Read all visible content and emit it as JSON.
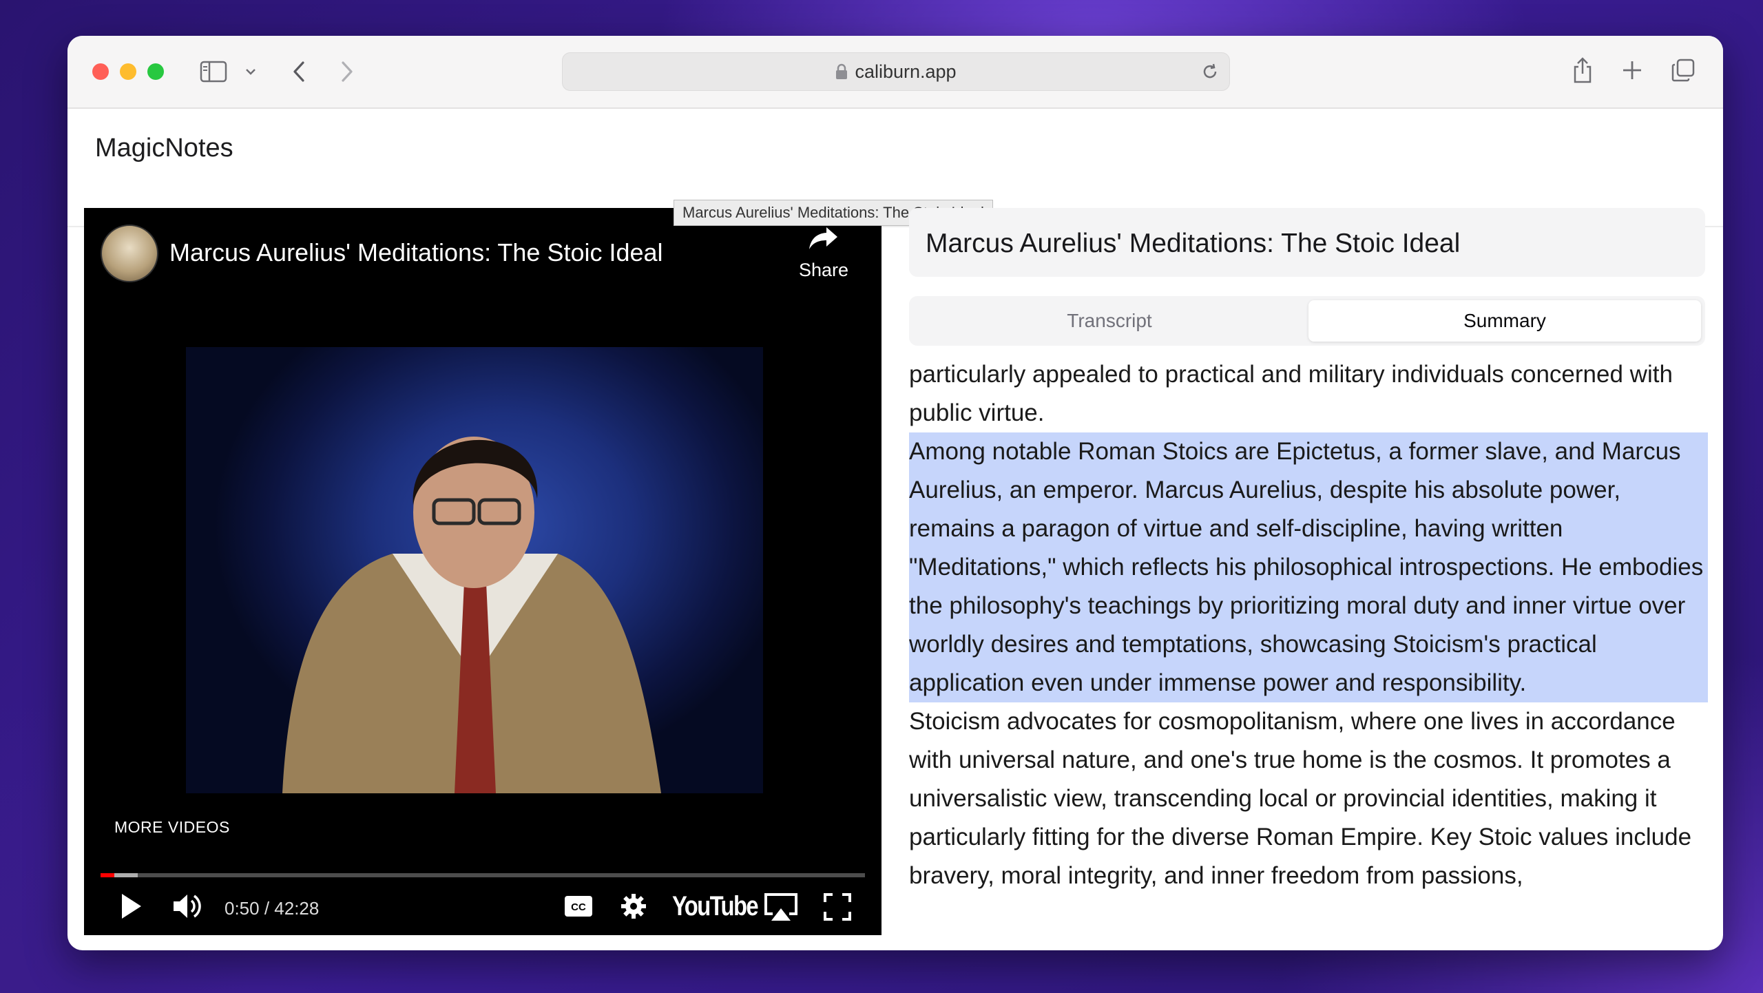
{
  "browser": {
    "url": "caliburn.app"
  },
  "app": {
    "title": "MagicNotes"
  },
  "video": {
    "title": "Marcus Aurelius' Meditations: The Stoic Ideal",
    "share_label": "Share",
    "more_videos_label": "MORE VIDEOS",
    "time": "0:50 / 42:28",
    "youtube_label": "YouTube",
    "progress_fraction": 0.02
  },
  "tooltip": {
    "text": "Marcus Aurelius' Meditations: The Stoic Ideal"
  },
  "panel": {
    "title": "Marcus Aurelius' Meditations: The Stoic Ideal",
    "tabs": [
      {
        "label": "Transcript",
        "selected": false
      },
      {
        "label": "Summary",
        "selected": true
      }
    ]
  },
  "summary": {
    "paragraphs": [
      {
        "text": "particularly appealed to practical and military individuals concerned with public virtue.",
        "highlighted": false
      },
      {
        "text": "Among notable Roman Stoics are Epictetus, a former slave, and Marcus Aurelius, an emperor. Marcus Aurelius, despite his absolute power, remains a paragon of virtue and self-discipline, having written \"Meditations,\" which reflects his philosophical introspections. He embodies the philosophy's teachings by prioritizing moral duty and inner virtue over worldly desires and temptations, showcasing Stoicism's practical application even under immense power and responsibility.",
        "highlighted": true
      },
      {
        "text": "Stoicism advocates for cosmopolitanism, where one lives in accordance with universal nature, and one's true home is the cosmos. It promotes a universalistic view, transcending local or provincial identities, making it particularly fitting for the diverse Roman Empire. Key Stoic values include bravery, moral integrity, and inner freedom from passions,",
        "highlighted": false
      }
    ]
  },
  "colors": {
    "highlight": "#c6d5fb",
    "progress": "#ff0000",
    "close": "#ff5f57",
    "minimize": "#febc2e",
    "zoom": "#28c840"
  },
  "icons": [
    "sidebar-icon",
    "chevron-down-icon",
    "back-icon",
    "forward-icon",
    "lock-icon",
    "reload-icon",
    "share-icon",
    "new-tab-icon",
    "tabs-overview-icon",
    "play-icon",
    "volume-icon",
    "captions-icon",
    "settings-icon",
    "airplay-icon",
    "fullscreen-icon"
  ]
}
